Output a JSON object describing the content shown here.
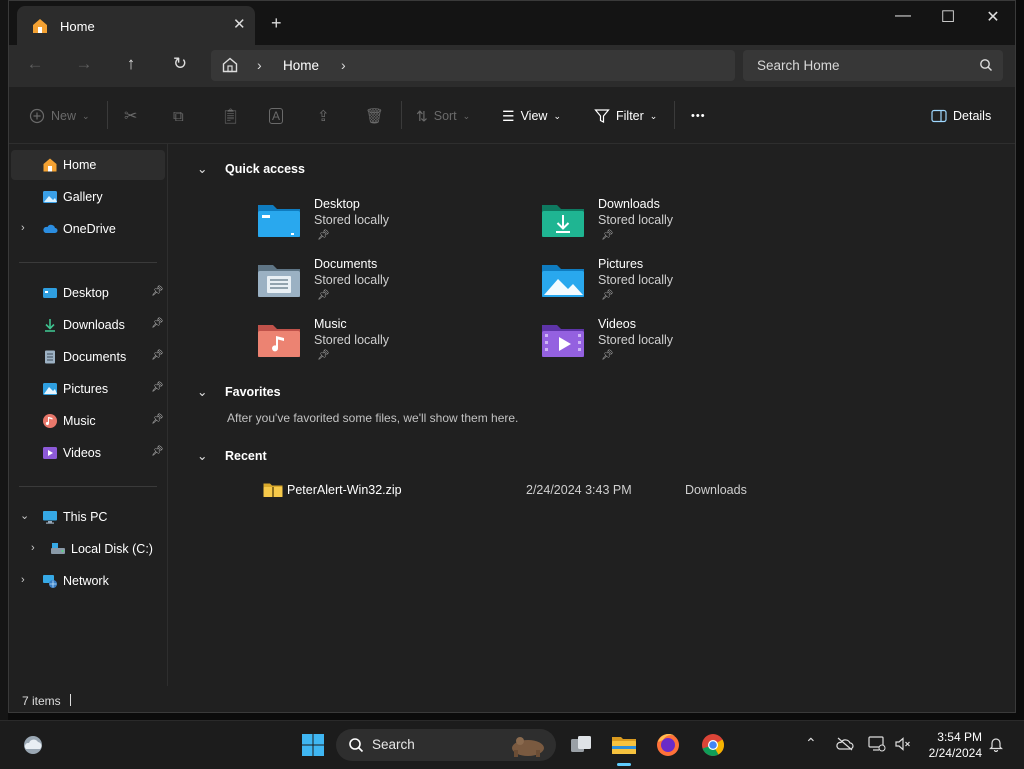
{
  "window": {
    "tab_title": "Home",
    "tab_close": "✕",
    "new_tab": "+",
    "controls": {
      "minimize": "—",
      "maximize": "☐",
      "close": "✕"
    }
  },
  "navbar": {
    "breadcrumb": "Home",
    "search_placeholder": "Search Home"
  },
  "toolbar": {
    "new_label": "New",
    "sort_label": "Sort",
    "view_label": "View",
    "filter_label": "Filter",
    "more_label": "•••",
    "details_label": "Details"
  },
  "sidebar": {
    "top": [
      {
        "label": "Home"
      },
      {
        "label": "Gallery"
      },
      {
        "label": "OneDrive"
      }
    ],
    "pinned": [
      {
        "label": "Desktop"
      },
      {
        "label": "Downloads"
      },
      {
        "label": "Documents"
      },
      {
        "label": "Pictures"
      },
      {
        "label": "Music"
      },
      {
        "label": "Videos"
      }
    ],
    "devices": [
      {
        "label": "This PC"
      },
      {
        "label": "Local Disk (C:)"
      },
      {
        "label": "Network"
      }
    ]
  },
  "content": {
    "quick_access_title": "Quick access",
    "quick_access": [
      {
        "name": "Desktop",
        "sub": "Stored locally"
      },
      {
        "name": "Downloads",
        "sub": "Stored locally"
      },
      {
        "name": "Documents",
        "sub": "Stored locally"
      },
      {
        "name": "Pictures",
        "sub": "Stored locally"
      },
      {
        "name": "Music",
        "sub": "Stored locally"
      },
      {
        "name": "Videos",
        "sub": "Stored locally"
      }
    ],
    "favorites_title": "Favorites",
    "favorites_empty": "After you've favorited some files, we'll show them here.",
    "recent_title": "Recent",
    "recent": [
      {
        "name": "PeterAlert-Win32.zip",
        "date": "2/24/2024 3:43 PM",
        "location": "Downloads"
      }
    ]
  },
  "status": {
    "items": "7 items"
  },
  "taskbar": {
    "search_label": "Search",
    "time": "3:54 PM",
    "date": "2/24/2024"
  },
  "colors": {
    "accent": "#60cdff",
    "window_bg": "#202020",
    "folder_blue": "#1e9bde",
    "folder_green": "#19a384",
    "folder_doc": "#8fa6b8",
    "folder_music": "#e8776a",
    "folder_video": "#8d5ad8"
  }
}
